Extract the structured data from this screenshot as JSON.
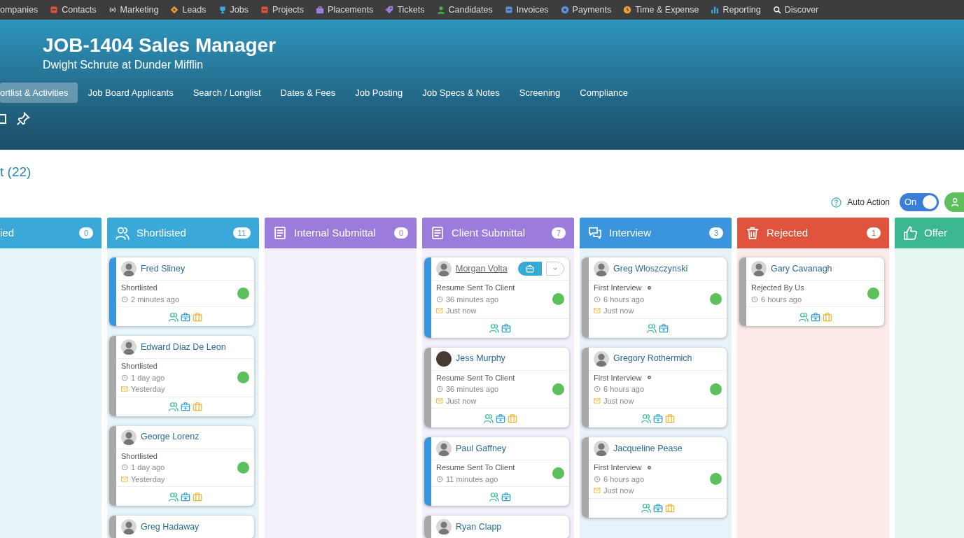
{
  "nav": [
    {
      "label": "ompanies"
    },
    {
      "label": "Contacts",
      "kind": "square",
      "color": "#e0533d"
    },
    {
      "label": "Marketing",
      "kind": "signal",
      "color": "#bbbbbb"
    },
    {
      "label": "Leads",
      "kind": "diamond",
      "color": "#f0a030"
    },
    {
      "label": "Jobs",
      "kind": "cup",
      "color": "#3aa8d8"
    },
    {
      "label": "Projects",
      "kind": "square",
      "color": "#e0533d"
    },
    {
      "label": "Placements",
      "kind": "case",
      "color": "#9b7bdc"
    },
    {
      "label": "Tickets",
      "kind": "tag",
      "color": "#9b7bdc"
    },
    {
      "label": "Candidates",
      "kind": "person",
      "color": "#4cb050"
    },
    {
      "label": "Invoices",
      "kind": "square",
      "color": "#5b8fe0"
    },
    {
      "label": "Payments",
      "kind": "circle",
      "color": "#5b8fe0"
    },
    {
      "label": "Time & Expense",
      "kind": "clock",
      "color": "#f0a030"
    },
    {
      "label": "Reporting",
      "kind": "bars",
      "color": "#3aa8d8"
    },
    {
      "label": "Discover",
      "kind": "search",
      "color": "#ffffff"
    }
  ],
  "header": {
    "title": "JOB-1404 Sales Manager",
    "subtitle": "Dwight Schrute at Dunder Mifflin"
  },
  "tabs": [
    {
      "label": "ortlist & Activities",
      "selected": true
    },
    {
      "label": "Job Board Applicants",
      "selected": false
    },
    {
      "label": "Search / Longlist",
      "selected": false
    },
    {
      "label": "Dates & Fees",
      "selected": false
    },
    {
      "label": "Job Posting",
      "selected": false
    },
    {
      "label": "Job Specs & Notes",
      "selected": false
    },
    {
      "label": "Screening",
      "selected": false
    },
    {
      "label": "Compliance",
      "selected": false
    }
  ],
  "section_title": "t (22)",
  "auto_action": {
    "label": "Auto Action",
    "on": true,
    "state_label": "On"
  },
  "columns": [
    {
      "title": "ied",
      "count": "0",
      "color": "#3aa8d8"
    },
    {
      "title": "Shortlisted",
      "count": "11",
      "kind": "people",
      "color": "#3aa8d8",
      "cards": [
        {
          "name": "Fred Sliney",
          "kind": "silhouette",
          "color": "#3a95dc",
          "status": "Shortlisted",
          "status_marker": false,
          "time": "2 minutes ago",
          "actions": [
            {
              "kind": "people"
            },
            {
              "kind": "medical"
            },
            {
              "kind": "case"
            }
          ],
          "hovered": false
        },
        {
          "name": "Edward Diaz De Leon",
          "kind": "silhouette",
          "color": "#a8a8a8",
          "status": "Shortlisted",
          "status_marker": false,
          "time": "1 day ago",
          "email": "Yesterday",
          "actions": [
            {
              "kind": "people"
            },
            {
              "kind": "medical"
            },
            {
              "kind": "case"
            }
          ],
          "hovered": false
        },
        {
          "name": "George Lorenz",
          "kind": "silhouette",
          "color": "#a8a8a8",
          "status": "Shortlisted",
          "status_marker": false,
          "time": "1 day ago",
          "email": "Yesterday",
          "actions": [
            {
              "kind": "people"
            },
            {
              "kind": "medical"
            },
            {
              "kind": "case"
            }
          ],
          "hovered": false
        },
        {
          "name": "Greg Hadaway",
          "kind": "silhouette",
          "color": "#a8a8a8",
          "hovered": false
        }
      ]
    },
    {
      "title": "Internal Submittal",
      "count": "0",
      "kind": "doc",
      "color": "#9b7bdc"
    },
    {
      "title": "Client Submittal",
      "count": "7",
      "kind": "doc",
      "color": "#9b7bdc",
      "cards": [
        {
          "name": "Morgan Volta",
          "kind": "silhouette",
          "color": "#3a95dc",
          "status": "Resume Sent To Client",
          "status_marker": false,
          "time": "36 minutes ago",
          "email": "Just now",
          "actions": [
            {
              "kind": "people"
            },
            {
              "kind": "medical"
            }
          ],
          "hovered": true
        },
        {
          "name": "Jess Murphy",
          "kind": "photo",
          "color": "#a8a8a8",
          "status": "Resume Sent To Client",
          "status_marker": false,
          "time": "36 minutes ago",
          "email": "Just now",
          "actions": [
            {
              "kind": "people"
            },
            {
              "kind": "medical"
            },
            {
              "kind": "case"
            }
          ],
          "hovered": false
        },
        {
          "name": "Paul Gaffney",
          "kind": "silhouette",
          "color": "#3a95dc",
          "status": "Resume Sent To Client",
          "status_marker": false,
          "time": "11 minutes ago",
          "actions": [
            {
              "kind": "people"
            },
            {
              "kind": "medical"
            }
          ],
          "hovered": false
        },
        {
          "name": "Ryan Clapp",
          "kind": "silhouette",
          "color": "#a8a8a8",
          "hovered": false
        }
      ]
    },
    {
      "title": "Interview",
      "count": "3",
      "kind": "chat",
      "color": "#3a95dc",
      "cards": [
        {
          "name": "Greg Wloszczynski",
          "kind": "silhouette",
          "color": "#a8a8a8",
          "status": "First Interview",
          "status_marker": true,
          "time": "6 hours ago",
          "email": "Just now",
          "actions": [
            {
              "kind": "people"
            },
            {
              "kind": "medical"
            }
          ],
          "hovered": false
        },
        {
          "name": "Gregory Rothermich",
          "kind": "silhouette",
          "color": "#a8a8a8",
          "status": "First Interview",
          "status_marker": true,
          "time": "6 hours ago",
          "email": "Just now",
          "actions": [
            {
              "kind": "people"
            },
            {
              "kind": "medical"
            },
            {
              "kind": "case"
            }
          ],
          "hovered": false
        },
        {
          "name": "Jacqueline Pease",
          "kind": "silhouette",
          "color": "#a8a8a8",
          "status": "First Interview",
          "status_marker": true,
          "time": "6 hours ago",
          "email": "Just now",
          "actions": [
            {
              "kind": "people"
            },
            {
              "kind": "medical"
            },
            {
              "kind": "case"
            }
          ],
          "hovered": false
        }
      ]
    },
    {
      "title": "Rejected",
      "count": "1",
      "kind": "trash",
      "color": "#e0533d",
      "cards": [
        {
          "name": "Gary Cavanagh",
          "kind": "silhouette",
          "color": "#a8a8a8",
          "status": "Rejected By Us",
          "status_marker": false,
          "time": "6 hours ago",
          "actions": [
            {
              "kind": "people"
            },
            {
              "kind": "medical"
            },
            {
              "kind": "case"
            }
          ],
          "hovered": false
        }
      ]
    },
    {
      "title": "Offer",
      "kind": "thumb",
      "color": "#3bb891"
    }
  ]
}
